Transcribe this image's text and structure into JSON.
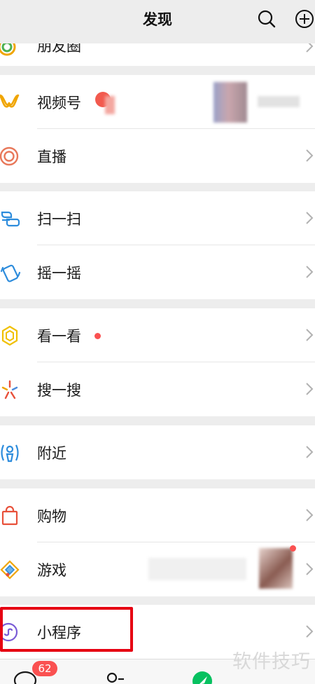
{
  "header": {
    "title": "发现",
    "search_icon": "search-icon",
    "add_icon": "plus-circle-icon"
  },
  "moments": {
    "label": "朋友圈",
    "icon": "moments-icon"
  },
  "channels": {
    "label": "视频号",
    "icon": "channels-icon"
  },
  "live": {
    "label": "直播",
    "icon": "live-icon"
  },
  "scan": {
    "label": "扫一扫",
    "icon": "scan-icon"
  },
  "shake": {
    "label": "摇一摇",
    "icon": "shake-icon"
  },
  "top_stories": {
    "label": "看一看",
    "icon": "top-stories-icon"
  },
  "search": {
    "label": "搜一搜",
    "icon": "search-feature-icon"
  },
  "nearby": {
    "label": "附近",
    "icon": "nearby-icon"
  },
  "shopping": {
    "label": "购物",
    "icon": "shopping-bag-icon"
  },
  "games": {
    "label": "游戏",
    "icon": "games-icon"
  },
  "mini_programs": {
    "label": "小程序",
    "icon": "mini-program-icon"
  },
  "tabbar": {
    "chats_badge": "62"
  },
  "watermark": "软件技巧",
  "colors": {
    "background": "#ededed",
    "card": "#ffffff",
    "badge": "#fa5151",
    "highlight": "#e60012",
    "wechat_green": "#07c160"
  }
}
